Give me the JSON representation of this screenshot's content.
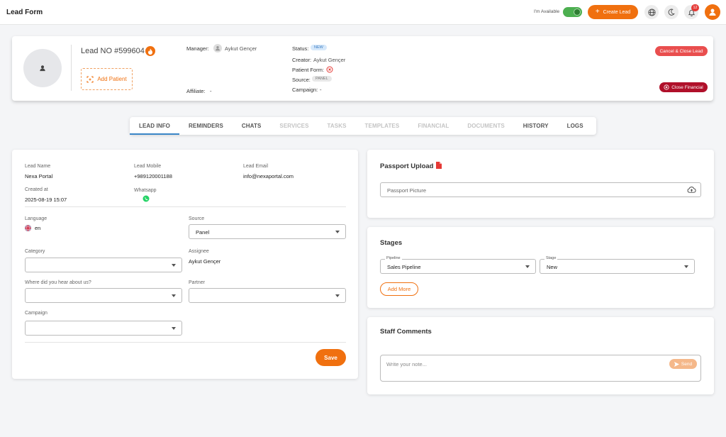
{
  "app": {
    "title": "Lead Form"
  },
  "topbar": {
    "availability_label": "I'm Available",
    "create_lead_label": "Create Lead",
    "notification_count": "12",
    "accent": "#f0700f"
  },
  "header": {
    "lead_no": "Lead NO #599604",
    "add_patient_label": "Add Patient",
    "manager_label": "Manager:",
    "manager_name": "Aykut Gençer",
    "affiliate_label": "Affiliate:",
    "affiliate_value": "-",
    "status_label": "Status:",
    "status_value": "NEW",
    "creator_label": "Creator:",
    "creator_value": "Aykut Gençer",
    "patient_form_label": "Patient Form:",
    "source_label": "Source:",
    "source_value": "PANEL",
    "campaign_label": "Campaign:",
    "campaign_value": "-",
    "cancel_close_label": "Cancel & Close Lead",
    "close_financial_label": "Close Financial"
  },
  "tabs": [
    {
      "label": "LEAD INFO",
      "state": "selected"
    },
    {
      "label": "REMINDERS",
      "state": "enabled"
    },
    {
      "label": "CHATS",
      "state": "enabled"
    },
    {
      "label": "SERVICES",
      "state": "disabled"
    },
    {
      "label": "TASKS",
      "state": "disabled"
    },
    {
      "label": "TEMPLATES",
      "state": "disabled"
    },
    {
      "label": "FINANCIAL",
      "state": "disabled"
    },
    {
      "label": "DOCUMENTS",
      "state": "disabled"
    },
    {
      "label": "HISTORY",
      "state": "enabled"
    },
    {
      "label": "LOGS",
      "state": "enabled"
    }
  ],
  "lead_info": {
    "lead_name_label": "Lead Name",
    "lead_name": "Nexa Portal",
    "lead_mobile_label": "Lead Mobile",
    "lead_mobile": "+989120001188",
    "lead_email_label": "Lead Email",
    "lead_email": "info@nexaportal.com",
    "created_at_label": "Created at",
    "created_at": "2025-08-19 15:07",
    "whatsapp_label": "Whatsapp",
    "language_label": "Language",
    "language_value": "en",
    "source_label": "Source",
    "source_value": "Panel",
    "category_label": "Category",
    "category_value": "",
    "assignee_label": "Assignee",
    "assignee_value": "Aykut Gençer",
    "hear_label": "Where did you hear about us?",
    "hear_value": "",
    "partner_label": "Partner",
    "partner_value": "",
    "campaign_label": "Campaign",
    "campaign_value": "",
    "save_label": "Save"
  },
  "passport": {
    "title": "Passport Upload",
    "placeholder": "Passport Picture"
  },
  "stages": {
    "title": "Stages",
    "pipeline_label": "Pipeline",
    "pipeline_value": "Sales Pipeline",
    "stage_label": "Stage",
    "stage_value": "New",
    "add_more_label": "Add More"
  },
  "comments": {
    "title": "Staff Comments",
    "placeholder": "Write your note...",
    "send_label": "Send"
  }
}
